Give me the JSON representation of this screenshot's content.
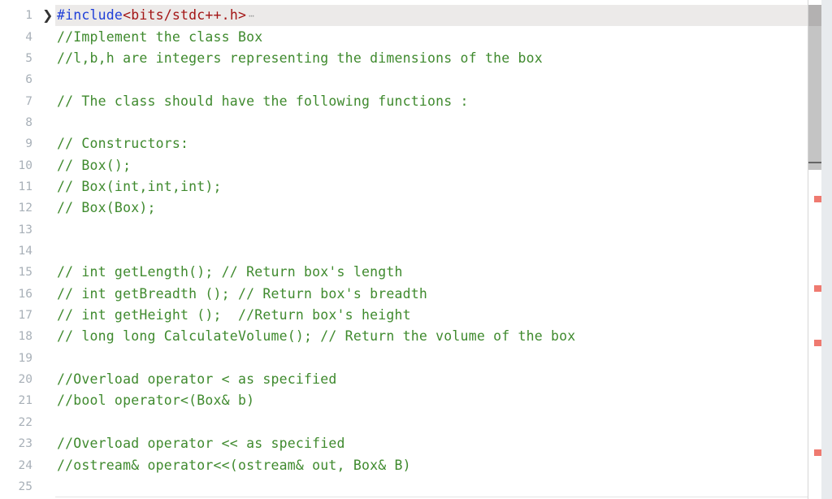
{
  "editor": {
    "colors": {
      "comment": "#3f8a2e",
      "keyword": "#1f3fd8",
      "string": "#a31515",
      "line_highlight": "#eceae9",
      "marker": "#ef7a70"
    },
    "first_line": {
      "number": "1",
      "fold_icon": "chevron-right-icon",
      "directive": "#include",
      "header": "<bits/stdc++.h>",
      "ellipsis": "⋯"
    },
    "lines": [
      {
        "number": "4",
        "text": "//Implement the class Box"
      },
      {
        "number": "5",
        "text": "//l,b,h are integers representing the dimensions of the box"
      },
      {
        "number": "6",
        "text": ""
      },
      {
        "number": "7",
        "text": "// The class should have the following functions :"
      },
      {
        "number": "8",
        "text": ""
      },
      {
        "number": "9",
        "text": "// Constructors:"
      },
      {
        "number": "10",
        "text": "// Box();"
      },
      {
        "number": "11",
        "text": "// Box(int,int,int);"
      },
      {
        "number": "12",
        "text": "// Box(Box);"
      },
      {
        "number": "13",
        "text": ""
      },
      {
        "number": "14",
        "text": ""
      },
      {
        "number": "15",
        "text": "// int getLength(); // Return box's length"
      },
      {
        "number": "16",
        "text": "// int getBreadth (); // Return box's breadth"
      },
      {
        "number": "17",
        "text": "// int getHeight ();  //Return box's height"
      },
      {
        "number": "18",
        "text": "// long long CalculateVolume(); // Return the volume of the box"
      },
      {
        "number": "19",
        "text": ""
      },
      {
        "number": "20",
        "text": "//Overload operator < as specified"
      },
      {
        "number": "21",
        "text": "//bool operator<(Box& b)"
      },
      {
        "number": "22",
        "text": ""
      },
      {
        "number": "23",
        "text": "//Overload operator << as specified"
      },
      {
        "number": "24",
        "text": "//ostream& operator<<(ostream& out, Box& B)"
      },
      {
        "number": "25",
        "text": ""
      }
    ]
  }
}
